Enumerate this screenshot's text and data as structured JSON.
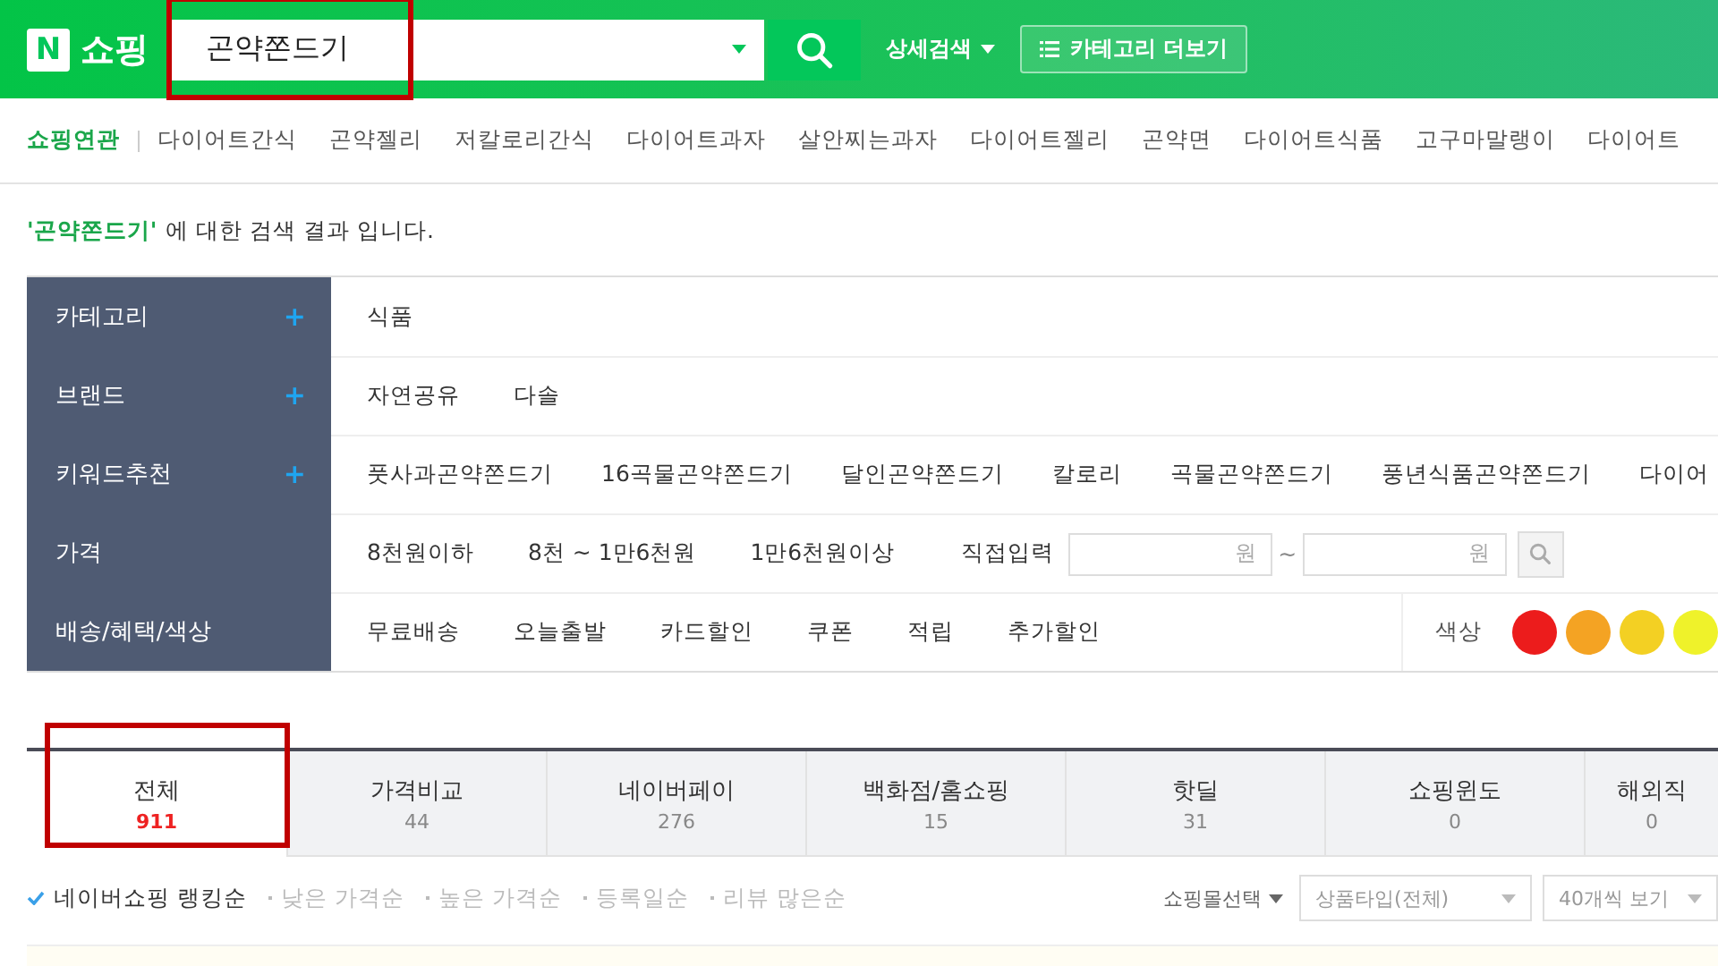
{
  "header": {
    "logo_mark": "N",
    "logo_text": "쇼핑",
    "search": {
      "value": "곤약쫀드기",
      "highlighted": true
    },
    "detail_search": "상세검색",
    "category_more": "카테고리 더보기"
  },
  "related": {
    "label": "쇼핑연관",
    "items": [
      "다이어트간식",
      "곤약젤리",
      "저칼로리간식",
      "다이어트과자",
      "살안찌는과자",
      "다이어트젤리",
      "곤약면",
      "다이어트식품",
      "고구마말랭이",
      "다이어트"
    ]
  },
  "result_notice": {
    "query": "'곤약쫀드기'",
    "suffix": "에 대한 검색 결과 입니다."
  },
  "filters": [
    {
      "label": "카테고리",
      "expand_icon": "+",
      "kind": "links",
      "items": [
        "식품"
      ]
    },
    {
      "label": "브랜드",
      "expand_icon": "+",
      "kind": "links",
      "items": [
        "자연공유",
        "다솔"
      ]
    },
    {
      "label": "키워드추천",
      "expand_icon": "+",
      "kind": "links",
      "items": [
        "풋사과곤약쫀드기",
        "16곡물곤약쫀드기",
        "달인곤약쫀드기",
        "칼로리",
        "곡물곤약쫀드기",
        "풍년식품곤약쫀드기",
        "다이어"
      ]
    },
    {
      "label": "가격",
      "kind": "price",
      "items": [
        "8천원이하",
        "8천 ~ 1만6천원",
        "1만6천원이상"
      ],
      "direct_label": "직접입력",
      "min_unit": "원",
      "separator": "~",
      "max_unit": "원"
    },
    {
      "label": "배송/혜택/색상",
      "kind": "colors",
      "items": [
        "무료배송",
        "오늘출발",
        "카드할인",
        "쿠폰",
        "적립",
        "추가할인"
      ],
      "color_label": "색상",
      "colors": [
        {
          "color": "#ec1c1c"
        },
        {
          "color": "#f4a323"
        },
        {
          "color": "#f3d023"
        },
        {
          "color": "#eff22a"
        }
      ]
    }
  ],
  "tabs": [
    {
      "label": "전체",
      "count": "911",
      "selected": true,
      "highlighted": true
    },
    {
      "label": "가격비교",
      "count": "44",
      "selected": false,
      "highlighted": false
    },
    {
      "label": "네이버페이",
      "count": "276",
      "selected": false,
      "highlighted": false
    },
    {
      "label": "백화점/홈쇼핑",
      "count": "15",
      "selected": false,
      "highlighted": false
    },
    {
      "label": "핫딜",
      "count": "31",
      "selected": false,
      "highlighted": false
    },
    {
      "label": "쇼핑윈도",
      "count": "0",
      "selected": false,
      "highlighted": false
    },
    {
      "label": "해외직",
      "count": "0",
      "selected": false,
      "highlighted": false
    }
  ],
  "sort": {
    "options": [
      {
        "label": "네이버쇼핑 랭킹순",
        "selected": true
      },
      {
        "label": "낮은 가격순",
        "selected": false
      },
      {
        "label": "높은 가격순",
        "selected": false
      },
      {
        "label": "등록일순",
        "selected": false
      },
      {
        "label": "리뷰 많은순",
        "selected": false
      }
    ],
    "shop_select": "쇼핑몰선택",
    "type_select": "상품타입(전체)",
    "per_page": "40개씩 보기"
  }
}
